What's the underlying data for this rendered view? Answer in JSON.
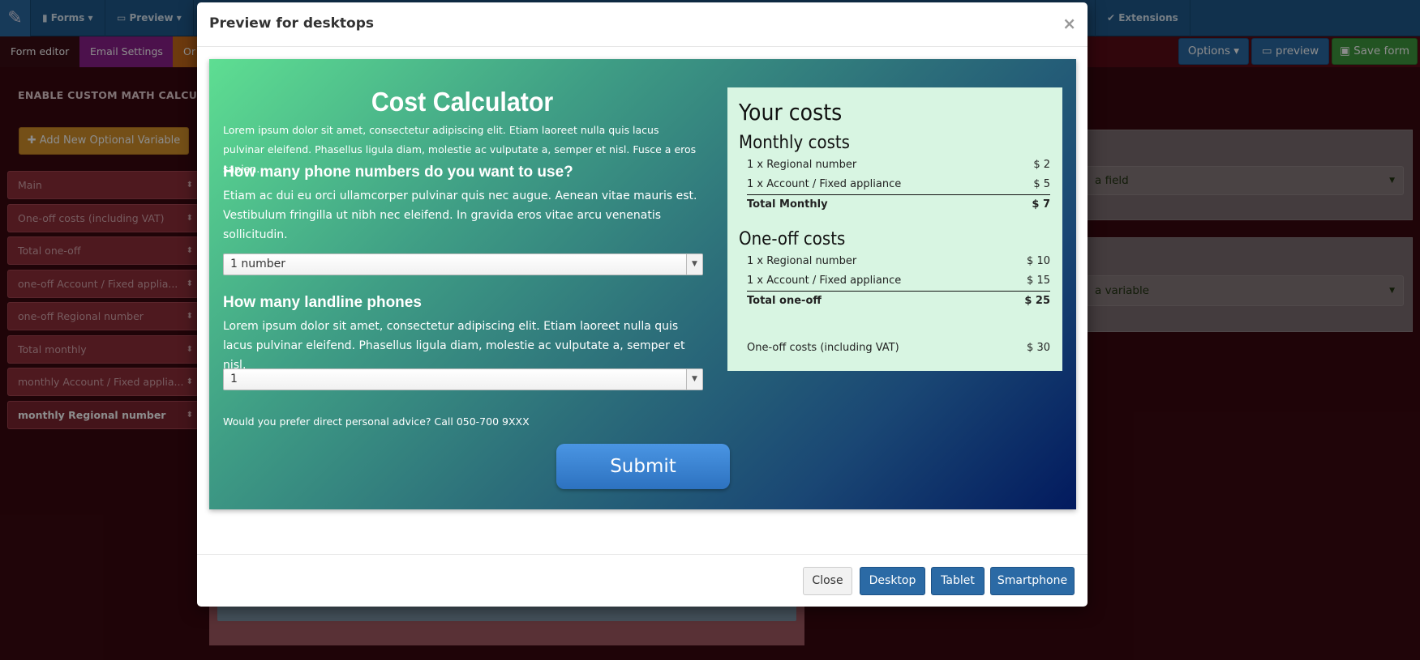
{
  "topnav": {
    "items": [
      "Forms",
      "Preview",
      "Extensions"
    ]
  },
  "subnav": {
    "tabs": [
      "Form editor",
      "Email Settings",
      "Or"
    ],
    "options_label": "Options",
    "preview_label": "preview",
    "save_label": "Save form"
  },
  "background": {
    "section_title": "ENABLE CUSTOM MATH CALCULAT",
    "add_var_label": "Add New Optional Variable",
    "variables": [
      "Main",
      "One-off costs (including VAT)",
      "Total one-off",
      "one-off Account / Fixed applia...",
      "one-off Regional number",
      "Total monthly",
      "monthly Account / Fixed applia...",
      "monthly Regional number"
    ],
    "select_field": "a field",
    "select_variable": "a variable"
  },
  "modal": {
    "title": "Preview for desktops",
    "close_symbol": "×",
    "footer": {
      "close": "Close",
      "desktop": "Desktop",
      "tablet": "Tablet",
      "smartphone": "Smartphone"
    }
  },
  "calculator": {
    "title": "Cost Calculator",
    "intro": "Lorem ipsum dolor sit amet, consectetur adipiscing elit. Etiam laoreet nulla quis lacus pulvinar eleifend. Phasellus ligula diam, molestie ac vulputate a, semper et nisl. Fusce a eros sapien.",
    "q1": "How many phone numbers do you want to use?",
    "q1_desc": "Etiam ac dui eu orci ullamcorper pulvinar quis nec augue. Aenean vitae mauris est. Vestibulum fringilla ut nibh nec eleifend. In gravida eros vitae arcu venenatis sollicitudin.",
    "q1_value": "1 number",
    "q2": "How many landline phones",
    "q2_desc": "Lorem ipsum dolor sit amet, consectetur adipiscing elit. Etiam laoreet nulla quis lacus pulvinar eleifend. Phasellus ligula diam, molestie ac vulputate a, semper et nisl.",
    "q2_value": "1",
    "advice": "Would you prefer direct personal advice? Call 050-700 9XXX",
    "submit": "Submit"
  },
  "costs": {
    "title": "Your costs",
    "monthly_heading": "Monthly costs",
    "monthly_rows": [
      {
        "label": "1 x Regional number",
        "value": "$ 2"
      },
      {
        "label": "1 x Account / Fixed appliance",
        "value": "$ 5"
      }
    ],
    "monthly_total": {
      "label": "Total Monthly",
      "value": "$ 7"
    },
    "oneoff_heading": "One-off costs",
    "oneoff_rows": [
      {
        "label": "1 x Regional number",
        "value": "$ 10"
      },
      {
        "label": "1 x Account / Fixed appliance",
        "value": "$ 15"
      }
    ],
    "oneoff_total": {
      "label": "Total one-off",
      "value": "$ 25"
    },
    "vat": {
      "label": "One-off costs (including VAT)",
      "value": "$ 30"
    }
  }
}
